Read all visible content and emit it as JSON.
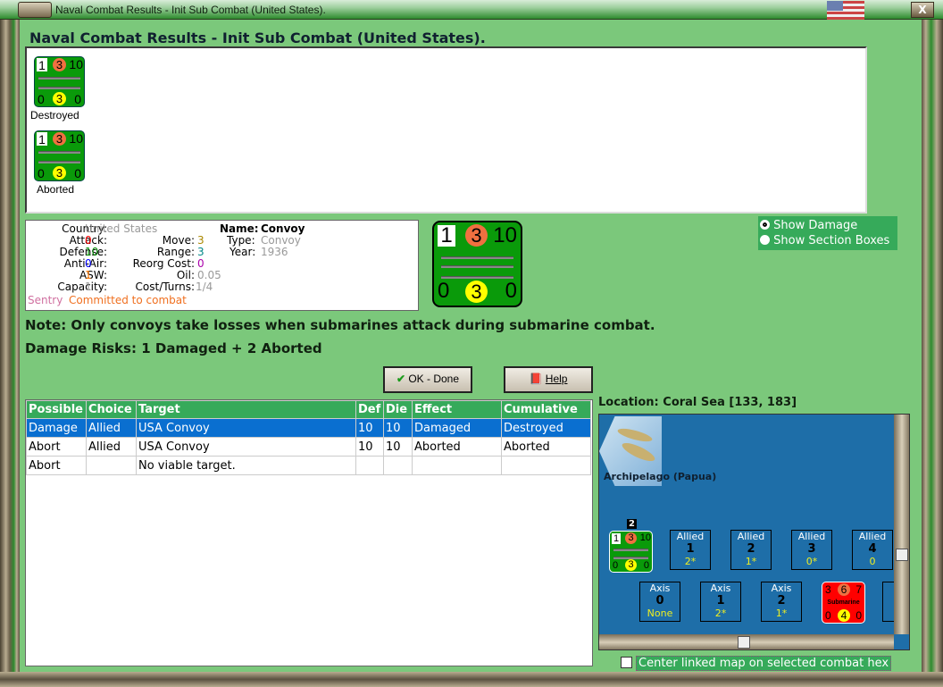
{
  "window": {
    "title": "Naval Combat Results - Init Sub Combat (United States).",
    "close_label": "X"
  },
  "heading": "Naval Combat Results - Init Sub Combat (United States).",
  "results": [
    {
      "label": "Destroyed",
      "attack": "1",
      "move": "3",
      "defense": "10",
      "left": "0",
      "mid": "3",
      "right": "0"
    },
    {
      "label": "Aborted",
      "attack": "1",
      "move": "3",
      "defense": "10",
      "left": "0",
      "mid": "3",
      "right": "0"
    }
  ],
  "unit": {
    "country_k": "Country:",
    "country": "United States",
    "attack_k": "Attack:",
    "attack": "0",
    "defense_k": "Defense:",
    "defense": "10",
    "aa_k": "Anti-Air:",
    "aa": "0",
    "asw_k": "ASW:",
    "asw": "1",
    "capacity_k": "Capacity:",
    "capacity": "1",
    "move_k": "Move:",
    "move": "3",
    "range_k": "Range:",
    "range": "3",
    "reorg_k": "Reorg Cost:",
    "reorg": "0",
    "oil_k": "Oil:",
    "oil": "0.05",
    "cost_k": "Cost/Turns:",
    "cost": "1/4",
    "name_k": "Name:",
    "name": "Convoy",
    "type_k": "Type:",
    "type": "Convoy",
    "year_k": "Year:",
    "year": "1936",
    "status1": "Sentry",
    "status2": "Committed to combat",
    "counter": {
      "attack": "1",
      "move": "3",
      "defense": "10",
      "left": "0",
      "mid": "3",
      "right": "0"
    }
  },
  "options": {
    "show_damage": "Show Damage",
    "show_section_boxes": "Show Section Boxes",
    "selected": "show_damage"
  },
  "note": "Note: Only convoys take losses when submarines attack during submarine combat.",
  "damage_risks": "Damage Risks:  1 Damaged + 2 Aborted",
  "buttons": {
    "ok": "OK - Done",
    "help": "Help"
  },
  "table": {
    "headers": [
      "Possible",
      "Choice",
      "Target",
      "Def",
      "Die",
      "Effect",
      "Cumulative"
    ],
    "rows": [
      [
        "Damage",
        "Allied",
        "USA Convoy",
        "10",
        "10",
        "Damaged",
        "Destroyed"
      ],
      [
        "Abort",
        "Allied",
        "USA Convoy",
        "10",
        "10",
        "Aborted",
        "Aborted"
      ],
      [
        "Abort",
        "",
        "No viable target.",
        "",
        "",
        "",
        ""
      ]
    ]
  },
  "location": "Location:  Coral Sea [133, 183]",
  "map": {
    "region": "Archipelago (Papua)",
    "stack_count": "2",
    "allied_counter": {
      "attack": "1",
      "move": "3",
      "defense": "10",
      "left": "0",
      "mid": "3",
      "right": "0"
    },
    "allied_boxes": [
      {
        "side": "Allied",
        "n": "1",
        "v": "2*"
      },
      {
        "side": "Allied",
        "n": "2",
        "v": "1*"
      },
      {
        "side": "Allied",
        "n": "3",
        "v": "0*"
      },
      {
        "side": "Allied",
        "n": "4",
        "v": "0"
      }
    ],
    "axis_boxes": [
      {
        "side": "Axis",
        "n": "0",
        "v": "None"
      },
      {
        "side": "Axis",
        "n": "1",
        "v": "2*"
      },
      {
        "side": "Axis",
        "n": "2",
        "v": "1*"
      }
    ],
    "sub_counter": {
      "attack": "3",
      "move": "6",
      "defense": "7",
      "label": "Submarine",
      "left": "0",
      "mid": "4",
      "right": "0"
    }
  },
  "center_checkbox": "Center linked map on selected combat hex"
}
